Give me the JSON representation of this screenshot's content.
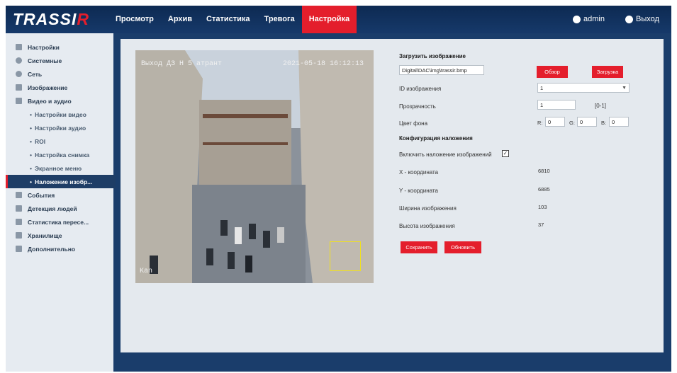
{
  "header": {
    "logo": {
      "text_main": "TRASSI",
      "text_accent": "R"
    },
    "tabs": [
      {
        "label": "Просмотр"
      },
      {
        "label": "Архив"
      },
      {
        "label": "Статистика"
      },
      {
        "label": "Тревога"
      },
      {
        "label": "Настройка",
        "active": true
      }
    ],
    "user_label": "admin",
    "logout_label": "Выход"
  },
  "sidebar": {
    "items": [
      {
        "label": "Настройки",
        "icon": "settings-icon"
      },
      {
        "label": "Системные",
        "icon": "info-icon"
      },
      {
        "label": "Сеть",
        "icon": "network-icon"
      },
      {
        "label": "Изображение",
        "icon": "image-icon"
      },
      {
        "label": "Видео и аудио",
        "icon": "video-icon"
      },
      {
        "label": "Настройки видео",
        "sub": true
      },
      {
        "label": "Настройки аудио",
        "sub": true
      },
      {
        "label": "ROI",
        "sub": true
      },
      {
        "label": "Настройка снимка",
        "sub": true
      },
      {
        "label": "Экранное меню",
        "sub": true
      },
      {
        "label": "Наложение изобр...",
        "sub": true,
        "active": true
      },
      {
        "label": "События",
        "icon": "bell-icon"
      },
      {
        "label": "Детекция людей",
        "icon": "person-detect-icon"
      },
      {
        "label": "Статистика пересе...",
        "icon": "chart-icon"
      },
      {
        "label": "Хранилище",
        "icon": "storage-icon"
      },
      {
        "label": "Дополнительно",
        "icon": "tools-icon"
      }
    ]
  },
  "preview": {
    "osd_top_left": "Выход ДЗ Н 5 атрант",
    "osd_top_right": "2021-05-18 16:12:13",
    "osd_bottom_left": "Kan"
  },
  "form": {
    "upload_title": "Загрузить изображение",
    "file_path": "Digital\\DAC\\img\\trassir.bmp",
    "browse_label": "Обзор",
    "upload_label": "Загрузка",
    "image_id_label": "ID изображения",
    "image_id_value": "1",
    "transparency_label": "Прозрачность",
    "transparency_value": "1",
    "transparency_range": "[0-1]",
    "bgcolor_label": "Цвет фона",
    "r_label": "R:",
    "r_value": "0",
    "g_label": "G:",
    "g_value": "0",
    "b_label": "B:",
    "b_value": "0",
    "overlay_config_title": "Конфигурация наложения",
    "enable_overlay_label": "Включить наложение изображений",
    "x_label": "X - координата",
    "x_value": "6810",
    "y_label": "Y - координата",
    "y_value": "6885",
    "width_label": "Ширина изображения",
    "width_value": "103",
    "height_label": "Высота изображения",
    "height_value": "37",
    "save_label": "Сохранить",
    "refresh_label": "Обновить"
  }
}
